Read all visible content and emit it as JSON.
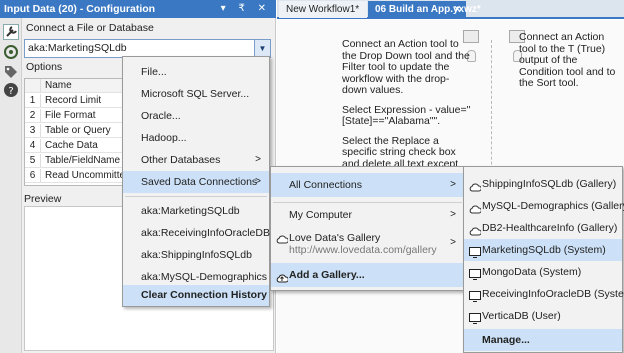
{
  "config_panel": {
    "title": "Input Data (20) - Configuration",
    "title_controls": "▾ ₹ ✕",
    "connect_label": "Connect a File or Database",
    "connection_value": "aka:MarketingSQLdb",
    "options_label": "Options",
    "options_header": "Name",
    "options": [
      {
        "num": "1",
        "name": "Record Limit"
      },
      {
        "num": "2",
        "name": "File Format"
      },
      {
        "num": "3",
        "name": "Table or Query"
      },
      {
        "num": "4",
        "name": "Cache Data"
      },
      {
        "num": "5",
        "name": "Table/FieldName SQ"
      },
      {
        "num": "6",
        "name": "Read Uncommitted"
      }
    ],
    "preview_label": "Preview"
  },
  "tabs": [
    {
      "label": "New Workflow1*"
    },
    {
      "label": "06 Build an App.yxwz*",
      "close": "✕"
    }
  ],
  "canvas": {
    "instructions": [
      "Connect an Action tool to the Drop Down tool and the Filter tool to update the workflow with the drop-down values.",
      "Select Expression - value=\"[State]==\"Alabama\"\".",
      "Select the Replace a specific string check box and delete all text except the word Alabama."
    ],
    "instructions_right": "Connect an Action tool to the T (True) output of the Condition tool and to the Sort tool."
  },
  "menu_main": {
    "items": [
      "File...",
      "Microsoft SQL Server...",
      "Oracle...",
      "Hadoop...",
      "Other Databases",
      "Saved Data Connections"
    ],
    "recent": [
      "aka:MarketingSQLdb",
      "aka:ReceivingInfoOracleDB",
      "aka:ShippingInfoSQLdb",
      "aka:MySQL-Demographics"
    ],
    "clear": "Clear Connection History",
    "arrow": ">"
  },
  "menu_saved": {
    "all": "All Connections",
    "my_computer": "My Computer",
    "gallery_name": "Love Data's Gallery",
    "gallery_url": "http://www.lovedata.com/gallery",
    "add_gallery": "Add a Gallery...",
    "arrow": ">"
  },
  "menu_connections": {
    "items": [
      {
        "label": "ShippingInfoSQLdb (Gallery)",
        "icon": "cloud-icon"
      },
      {
        "label": "MySQL-Demographics (Gallery)",
        "icon": "cloud-icon"
      },
      {
        "label": "DB2-HealthcareInfo (Gallery)",
        "icon": "cloud-icon"
      },
      {
        "label": "MarketingSQLdb (System)",
        "icon": "monitor-icon"
      },
      {
        "label": "MongoData (System)",
        "icon": "monitor-icon"
      },
      {
        "label": "ReceivingInfoOracleDB (System)",
        "icon": "monitor-icon"
      },
      {
        "label": "VerticaDB (User)",
        "icon": "monitor-icon"
      }
    ],
    "manage": "Manage..."
  },
  "colors": {
    "accent": "#3a78c3",
    "highlight": "#cce1f7"
  }
}
